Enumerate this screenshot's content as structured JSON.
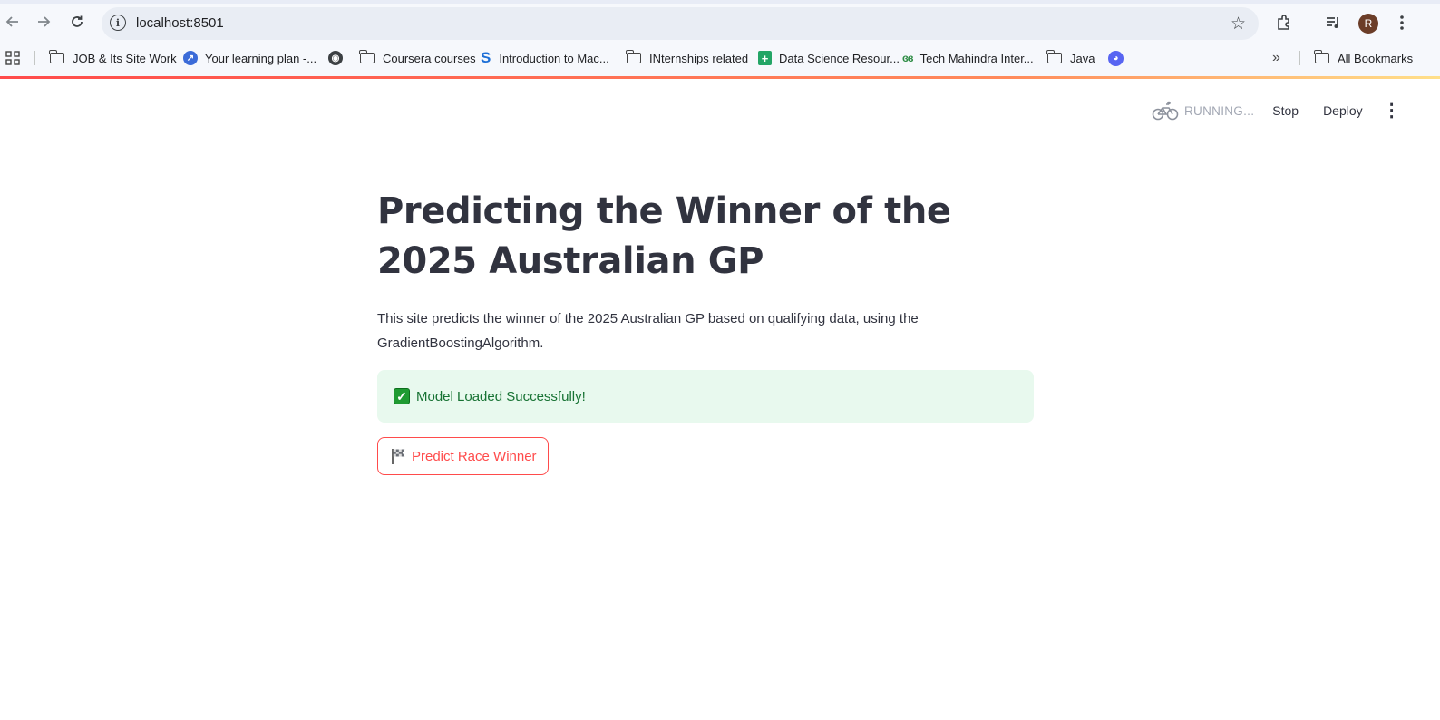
{
  "browser": {
    "url": "localhost:8501",
    "avatar_letter": "R",
    "bookmarks": [
      {
        "label": "JOB & Its Site Work",
        "icon": "folder-icon"
      },
      {
        "label": "Your learning plan -...",
        "icon": "learning-icon"
      },
      {
        "label": "",
        "icon": "globe-icon"
      },
      {
        "label": "Coursera courses",
        "icon": "folder-icon"
      },
      {
        "label": "Introduction to Mac...",
        "icon": "s-logo-icon"
      },
      {
        "label": "INternships related",
        "icon": "folder-icon"
      },
      {
        "label": "Data Science Resour...",
        "icon": "sheets-icon"
      },
      {
        "label": "Tech Mahindra Inter...",
        "icon": "gfg-icon"
      },
      {
        "label": "Java",
        "icon": "folder-icon"
      },
      {
        "label": "",
        "icon": "discord-icon"
      }
    ],
    "overflow": "»",
    "all_bookmarks": "All Bookmarks"
  },
  "header": {
    "status": "RUNNING...",
    "stop": "Stop",
    "deploy": "Deploy"
  },
  "main": {
    "title": "Predicting the Winner of the 2025 Australian GP",
    "description": "This site predicts the winner of the 2025 Australian GP based on qualifying data, using the GradientBoostingAlgorithm.",
    "alert": "Model Loaded Successfully!",
    "button": "Predict Race Winner"
  },
  "colors": {
    "accent": "#ff4b4b",
    "success_bg": "#e8f9ee",
    "success_text": "#177233",
    "text": "#31333f"
  }
}
